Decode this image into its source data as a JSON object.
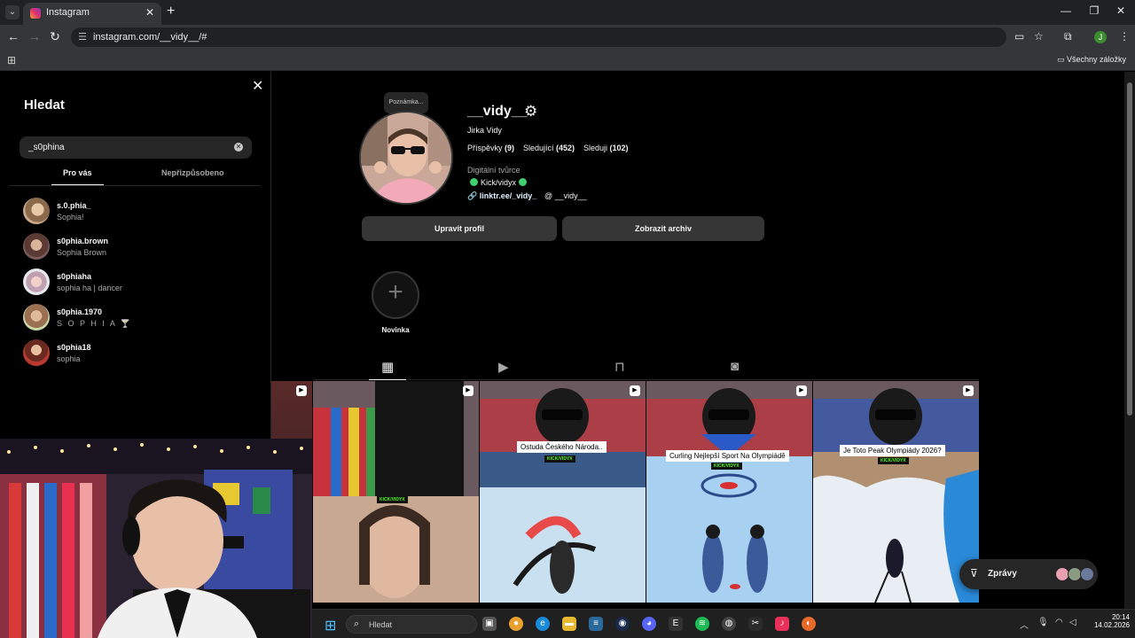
{
  "browser": {
    "tab_title": "Instagram",
    "url": "instagram.com/__vidy__/#",
    "profile_initial": "J",
    "all_bookmarks": "Všechny záložky"
  },
  "search": {
    "title": "Hledat",
    "query": "_s0phina",
    "tabs": [
      "Pro vás",
      "Nepřizpůsobeno"
    ],
    "results": [
      {
        "username": "s.0.phia_",
        "name": "Sophia!"
      },
      {
        "username": "s0phia.brown",
        "name": "Sophia Brown"
      },
      {
        "username": "s0phiaha",
        "name": "sophia ha | dancer"
      },
      {
        "username": "s0phia.1970",
        "name": "S O P H I A 🍸"
      },
      {
        "username": "s0phia18",
        "name": "sophia"
      }
    ]
  },
  "profile": {
    "note": "Poznámka...",
    "username": "__vidy__",
    "full_name": "Jirka Vidy",
    "stats": {
      "posts_label": "Příspěvky",
      "posts": "(9)",
      "followers_label": "Sledující",
      "followers": "(452)",
      "following_label": "Sleduji",
      "following": "(102)"
    },
    "category": "Digitální tvůrce",
    "bio_line": "Kick/vidyx",
    "link": "linktr.ee/_vidy_",
    "threads": "__vidy__",
    "edit_button": "Upravit profil",
    "archive_button": "Zobrazit archiv",
    "highlight_label": "Novinka"
  },
  "posts": [
    {
      "caption": ""
    },
    {
      "caption": ""
    },
    {
      "caption": "Ostuda Českého Národa.."
    },
    {
      "caption": "Curling Nejlepší Sport Na Olympiádě"
    },
    {
      "caption": "Je Toto Peak Olympiády 2026?"
    }
  ],
  "kick_tag": "KICK/VIDYX",
  "messages": {
    "label": "Zprávy"
  },
  "taskbar": {
    "search_placeholder": "Hledat",
    "time": "20:14",
    "date": "14.02.2026"
  }
}
